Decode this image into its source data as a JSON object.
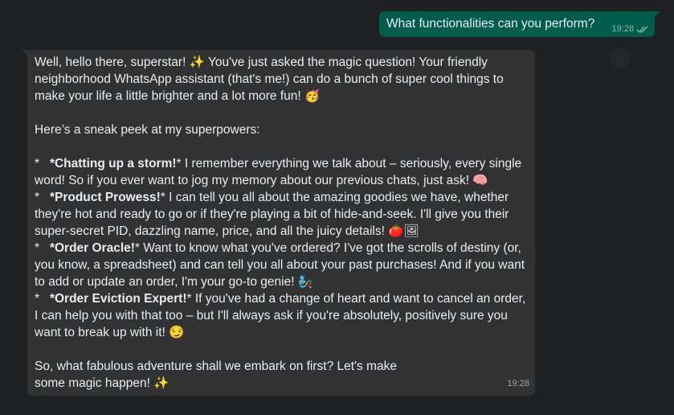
{
  "outgoing": {
    "text": "What functionalities can you perform?",
    "time": "19:28",
    "status_icon": "double-check-icon"
  },
  "incoming": {
    "time": "19:28",
    "intro": "Well, hello there, superstar! ✨ You've just asked the magic question! Your friendly neighborhood WhatsApp assistant (that's me!) can do a bunch of super cool things to make your life a little brighter and a lot more fun! 🥳",
    "lead": "Here’s a sneak peek at my superpowers:",
    "items": [
      {
        "prefix": "*   ",
        "title": "*Chatting up a storm!",
        "body": "* I remember everything we talk about – seriously, every single word! So if you ever want to jog my memory about our previous chats, just ask! 🧠"
      },
      {
        "prefix": "*   ",
        "title": "*Product Prowess!",
        "body": "* I can tell you all about the amazing goodies we have, whether they're hot and ready to go or if they're playing a bit of hide-and-seek. I'll give you their super-secret PID, dazzling name, price, and all the juicy details! 🍅🖼"
      },
      {
        "prefix": "*   ",
        "title": "*Order Oracle!",
        "body": "* Want to know what you've ordered? I've got the scrolls of destiny (or, you know, a spreadsheet) and can tell you all about your past purchases! And if you want to add or update an order, I'm your go-to genie! 🧞"
      },
      {
        "prefix": "*   ",
        "title": "*Order Eviction Expert!",
        "body": "* If you've had a change of heart and want to cancel an order, I can help you with that too – but I'll always ask if you're absolutely, positively sure you want to break up with it! 😏"
      }
    ],
    "closing_line1": "So, what fabulous adventure shall we embark on first? Let's make",
    "closing_line2": "some magic happen! ✨"
  }
}
